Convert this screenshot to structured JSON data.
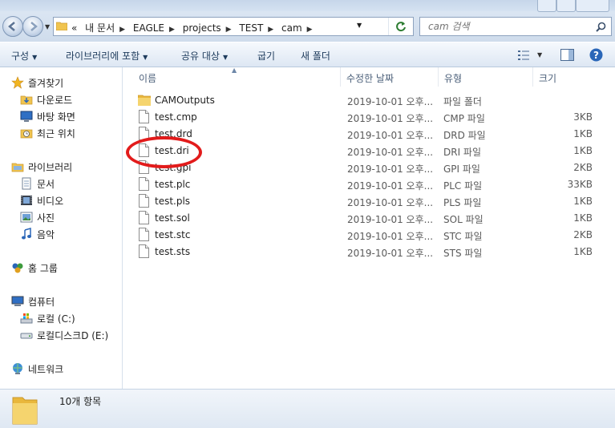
{
  "address": {
    "crumbs": [
      "내 문서",
      "EAGLE",
      "projects",
      "TEST",
      "cam"
    ],
    "overflow": "«"
  },
  "search": {
    "placeholder": "cam 검색"
  },
  "toolbar": {
    "organize": "구성",
    "include_in_library": "라이브러리에 포함",
    "share_with": "공유 대상",
    "burn": "굽기",
    "new_folder": "새 폴더"
  },
  "nav": {
    "favorites": "즐겨찾기",
    "downloads": "다운로드",
    "desktop": "바탕 화면",
    "recent": "최근 위치",
    "libraries": "라이브러리",
    "documents": "문서",
    "videos": "비디오",
    "pictures": "사진",
    "music": "음악",
    "homegroup": "홈 그룹",
    "computer": "컴퓨터",
    "local_disk_c": "로컬 (C:)",
    "local_disk_e": "로컬디스크D (E:)",
    "network": "네트워크"
  },
  "columns": {
    "name": "이름",
    "date": "수정한 날짜",
    "type": "유형",
    "size": "크기"
  },
  "files": [
    {
      "name": "CAMOutputs",
      "date": "2019-10-01 오후...",
      "type": "파일 폴더",
      "size": "",
      "icon": "folder-icon"
    },
    {
      "name": "test.cmp",
      "date": "2019-10-01 오후...",
      "type": "CMP 파일",
      "size": "3KB",
      "icon": "file-icon"
    },
    {
      "name": "test.drd",
      "date": "2019-10-01 오후...",
      "type": "DRD 파일",
      "size": "1KB",
      "icon": "file-icon"
    },
    {
      "name": "test.dri",
      "date": "2019-10-01 오후...",
      "type": "DRI 파일",
      "size": "1KB",
      "icon": "file-icon"
    },
    {
      "name": "test.gpi",
      "date": "2019-10-01 오후...",
      "type": "GPI 파일",
      "size": "2KB",
      "icon": "file-icon"
    },
    {
      "name": "test.plc",
      "date": "2019-10-01 오후...",
      "type": "PLC 파일",
      "size": "33KB",
      "icon": "file-icon"
    },
    {
      "name": "test.pls",
      "date": "2019-10-01 오후...",
      "type": "PLS 파일",
      "size": "1KB",
      "icon": "file-icon"
    },
    {
      "name": "test.sol",
      "date": "2019-10-01 오후...",
      "type": "SOL 파일",
      "size": "1KB",
      "icon": "file-icon"
    },
    {
      "name": "test.stc",
      "date": "2019-10-01 오후...",
      "type": "STC 파일",
      "size": "2KB",
      "icon": "file-icon"
    },
    {
      "name": "test.sts",
      "date": "2019-10-01 오후...",
      "type": "STS 파일",
      "size": "1KB",
      "icon": "file-icon"
    }
  ],
  "status": {
    "item_count": "10개 항목"
  },
  "colors": {
    "annotation": "#e21b1b",
    "toolbar_text": "#1e3b5c",
    "folder": "#f0c44f"
  }
}
